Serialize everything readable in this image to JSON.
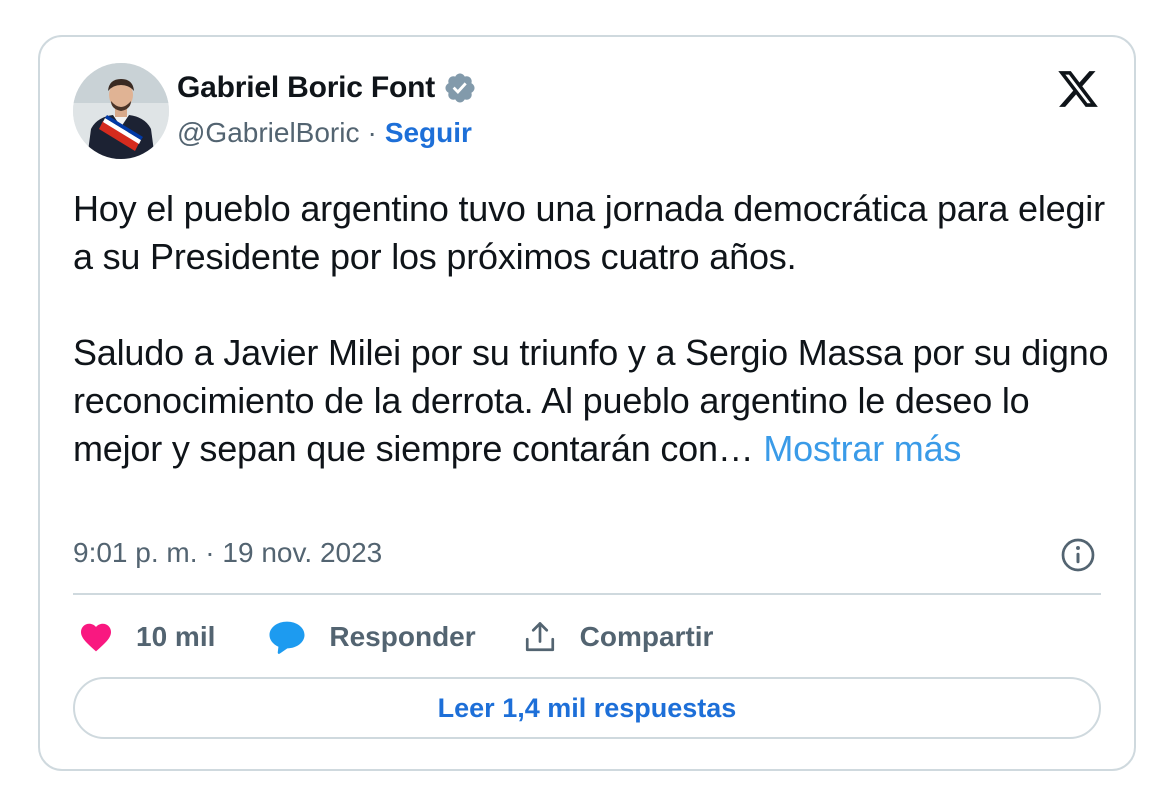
{
  "author": {
    "display_name": "Gabriel Boric Font",
    "handle": "@GabrielBoric",
    "separator": "·",
    "follow_label": "Seguir",
    "verified_icon": "verified-badge-icon",
    "avatar": "profile-photo"
  },
  "brand": {
    "logo_icon": "x-logo-icon"
  },
  "tweet": {
    "paragraph_1": "Hoy el pueblo argentino tuvo una jornada democrática para elegir a su Presidente por los próximos cuatro años.",
    "paragraph_2": "Saludo a Javier Milei por su triunfo y a Sergio Massa por su digno reconocimiento de la derrota. Al pueblo argentino le deseo lo mejor y sepan que siempre contarán con…",
    "show_more_label": "Mostrar más",
    "timestamp": "9:01 p. m. · 19 nov. 2023"
  },
  "actions": {
    "like_count": "10 mil",
    "reply_label": "Responder",
    "share_label": "Compartir",
    "like_icon": "heart-icon",
    "reply_icon": "speech-bubble-icon",
    "share_icon": "share-upload-icon",
    "info_icon": "info-icon"
  },
  "replies": {
    "button_label": "Leer 1,4 mil respuestas"
  },
  "colors": {
    "like": "#f91880",
    "reply": "#1d9bf0",
    "link": "#1d6fd8",
    "show_more": "#3a9be8",
    "muted": "#536471",
    "border": "#cfd9de",
    "verified": "#829aab"
  }
}
